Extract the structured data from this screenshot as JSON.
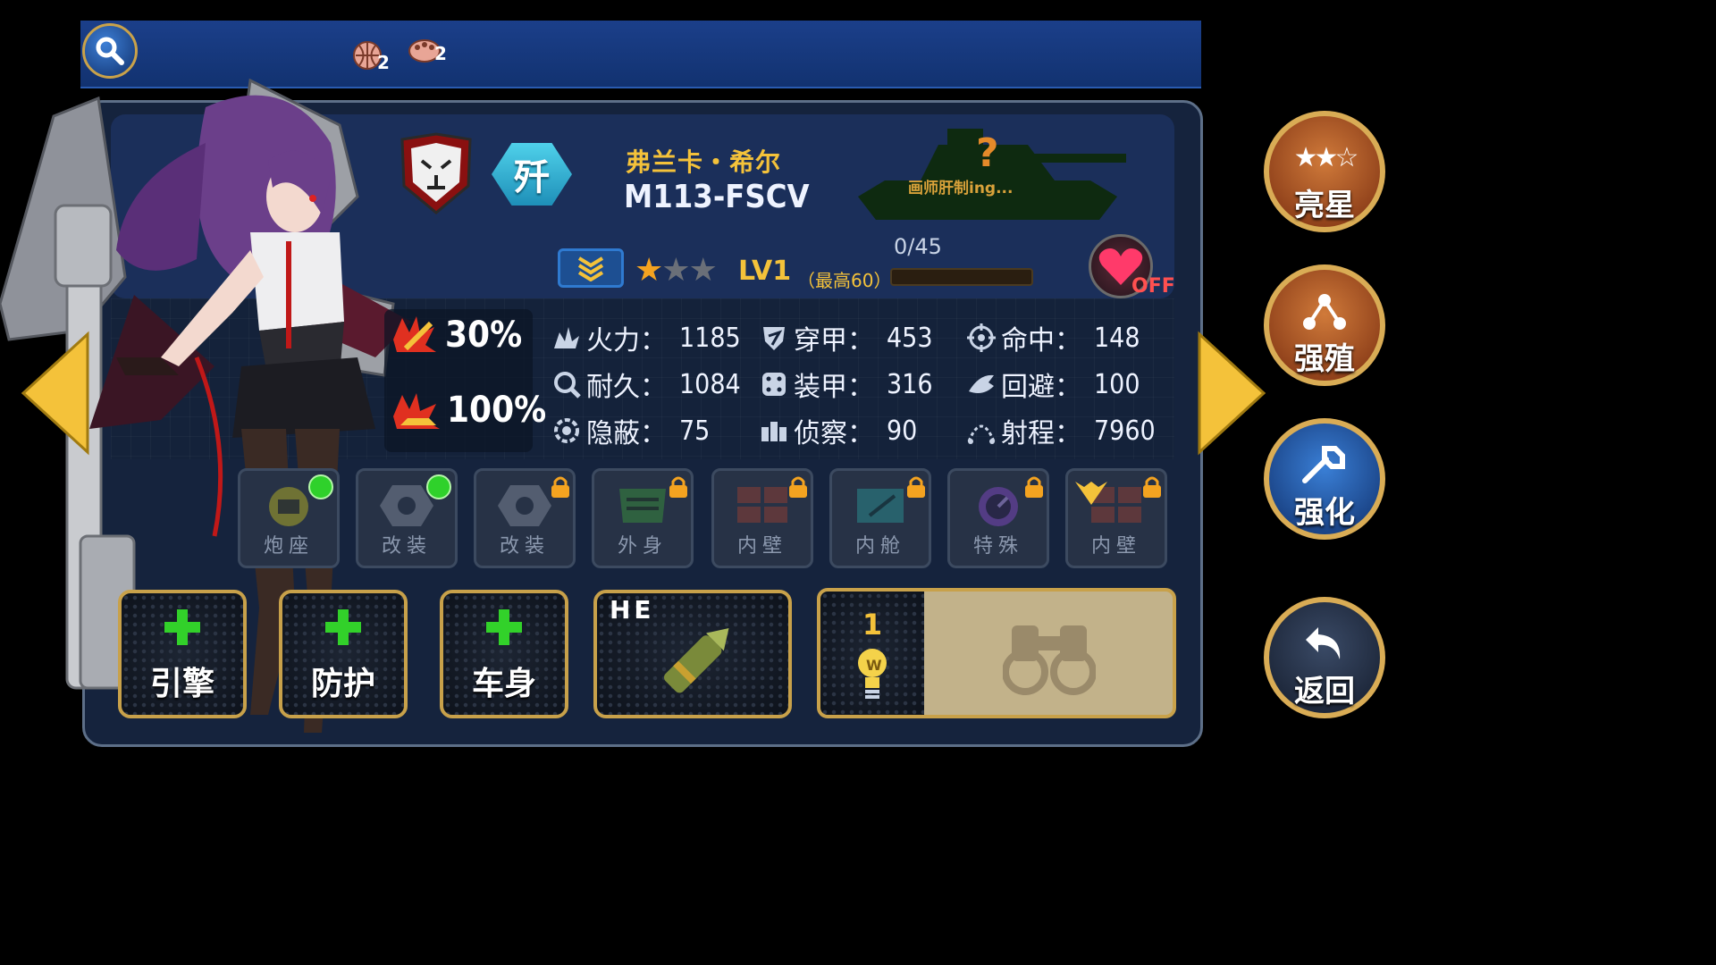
{
  "top_bar": {
    "resources": [
      {
        "icon": "ball-icon",
        "count": "2"
      },
      {
        "icon": "palette-icon",
        "count": "2"
      }
    ]
  },
  "tank": {
    "name_cn": "弗兰卡・希尔",
    "model": "M113-FSCV",
    "class_badge": "歼",
    "painter_note": "画师肝制ing...",
    "level": "LV1",
    "max_level": "（最高60）",
    "exp": "0/45",
    "exp_fraction": 0,
    "stars_filled": 1,
    "stars_total": 3,
    "favorite_status": "OFF"
  },
  "bonuses": [
    {
      "icon": "crit-icon",
      "value": "30%"
    },
    {
      "icon": "tank-damage-icon",
      "value": "100%"
    }
  ],
  "stats": [
    {
      "icon": "firepower-icon",
      "label": "火力：",
      "value": "1185"
    },
    {
      "icon": "penetration-icon",
      "label": "穿甲：",
      "value": "453"
    },
    {
      "icon": "accuracy-icon",
      "label": "命中：",
      "value": "148"
    },
    {
      "icon": "durability-icon",
      "label": "耐久：",
      "value": "1084"
    },
    {
      "icon": "armor-icon",
      "label": "装甲：",
      "value": "316"
    },
    {
      "icon": "evasion-icon",
      "label": "回避：",
      "value": "100"
    },
    {
      "icon": "stealth-icon",
      "label": "隐蔽：",
      "value": "75"
    },
    {
      "icon": "recon-icon",
      "label": "侦察：",
      "value": "90"
    },
    {
      "icon": "range-icon",
      "label": "射程：",
      "value": "7960"
    }
  ],
  "slots": [
    {
      "label": "炮座",
      "status": "available"
    },
    {
      "label": "改装",
      "status": "available"
    },
    {
      "label": "改装",
      "status": "locked"
    },
    {
      "label": "外身",
      "status": "locked"
    },
    {
      "label": "内壁",
      "status": "locked"
    },
    {
      "label": "内舱",
      "status": "locked"
    },
    {
      "label": "特殊",
      "status": "locked"
    },
    {
      "label": "内壁",
      "status": "locked"
    }
  ],
  "equipment_buttons": [
    {
      "label": "引擎"
    },
    {
      "label": "防护"
    },
    {
      "label": "车身"
    }
  ],
  "ammo": {
    "label": "HE"
  },
  "recon": {
    "count": "1"
  },
  "side_buttons": [
    {
      "label": "亮星",
      "icon": "stars-icon"
    },
    {
      "label": "强殖",
      "icon": "network-icon"
    },
    {
      "label": "强化",
      "icon": "wrench-icon"
    },
    {
      "label": "返回",
      "icon": "back-arrow-icon"
    }
  ],
  "colors": {
    "accent_gold": "#f4c23a",
    "slot_ready_green": "#2fd12b",
    "panel_blue": "#1b2f5a"
  }
}
